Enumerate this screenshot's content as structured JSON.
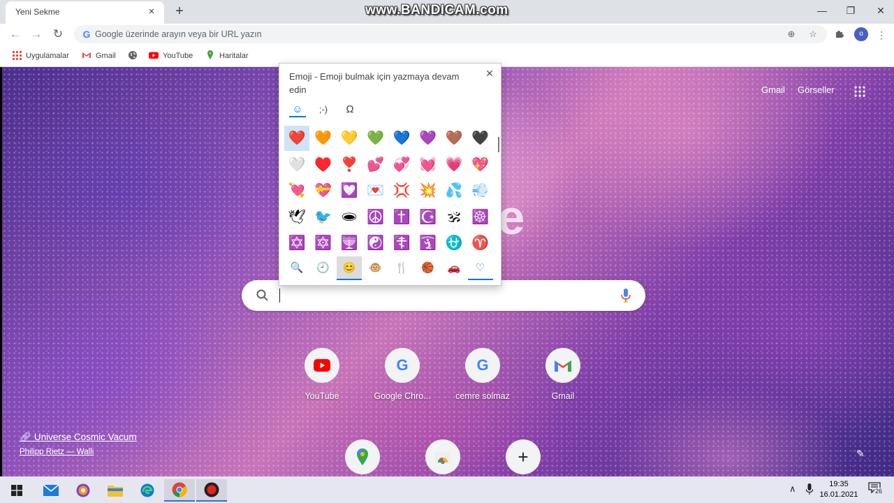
{
  "tab": {
    "title": "Yeni Sekme",
    "close": "×",
    "new": "+"
  },
  "watermark": "www.BANDICAM.com",
  "window": {
    "minimize": "—",
    "maximize": "❐",
    "close": "✕"
  },
  "omnibox": {
    "placeholder": "Google üzerinde arayın veya bir URL yazın",
    "g": "G"
  },
  "profile_initial": "o",
  "bookmarks": [
    {
      "label": "Uygulamalar",
      "icon": "apps-icon"
    },
    {
      "label": "Gmail",
      "icon": "gmail-icon"
    },
    {
      "label": "",
      "icon": "globe-icon"
    },
    {
      "label": "YouTube",
      "icon": "youtube-icon"
    },
    {
      "label": "Haritalar",
      "icon": "maps-icon"
    }
  ],
  "header_links": {
    "gmail": "Gmail",
    "images": "Görseller"
  },
  "logo_partial": "le",
  "shortcuts": [
    {
      "label": "YouTube",
      "icon": "youtube-icon"
    },
    {
      "label": "Google Chro...",
      "icon": "google-icon"
    },
    {
      "label": "cemre solmaz",
      "icon": "google-icon"
    },
    {
      "label": "Gmail",
      "icon": "gmail-icon"
    }
  ],
  "shortcuts_row2": [
    {
      "icon": "maps-icon"
    },
    {
      "icon": "chrome-web-store-icon"
    },
    {
      "icon": "add-shortcut-icon",
      "glyph": "+"
    }
  ],
  "credit": {
    "title": "Universe Cosmic Vacum",
    "author": "Philipp Rietz — Walli"
  },
  "emoji_panel": {
    "title": "Emoji - Emoji bulmak için yazmaya devam edin",
    "close": "✕",
    "tabs": [
      "☺",
      ";-)",
      "Ω"
    ],
    "rows": [
      [
        "❤️",
        "🧡",
        "💛",
        "💚",
        "💙",
        "💜",
        "🤎",
        "🖤"
      ],
      [
        "🤍",
        "♥️",
        "❣️",
        "💕",
        "💞",
        "💓",
        "💗",
        "💖"
      ],
      [
        "💘",
        "💝",
        "💟",
        "💌",
        "💢",
        "💥",
        "💦",
        "💨"
      ],
      [
        "🕊",
        "🐦",
        "🕳",
        "☮️",
        "✝️",
        "☪️",
        "🕉",
        "☸️"
      ],
      [
        "✡️",
        "🔯",
        "🕎",
        "☯️",
        "☦️",
        "🛐",
        "⛎",
        "♈"
      ]
    ],
    "categories": [
      "🔍",
      "🕘",
      "😊",
      "🐵",
      "🍴",
      "🏀",
      "🚗",
      "♡"
    ]
  },
  "taskbar": {
    "apps": [
      "start-icon",
      "mail-icon",
      "browser-icon",
      "file-explorer-icon",
      "edge-icon",
      "chrome-icon",
      "bandicam-icon"
    ],
    "time": "19:35",
    "date": "16.01.2021",
    "tray_up": "∧",
    "notification_count": "26"
  },
  "colors": {
    "accent": "#0078d4",
    "tabstrip": "#dee1e6",
    "taskbar": "#e6e6f0"
  }
}
